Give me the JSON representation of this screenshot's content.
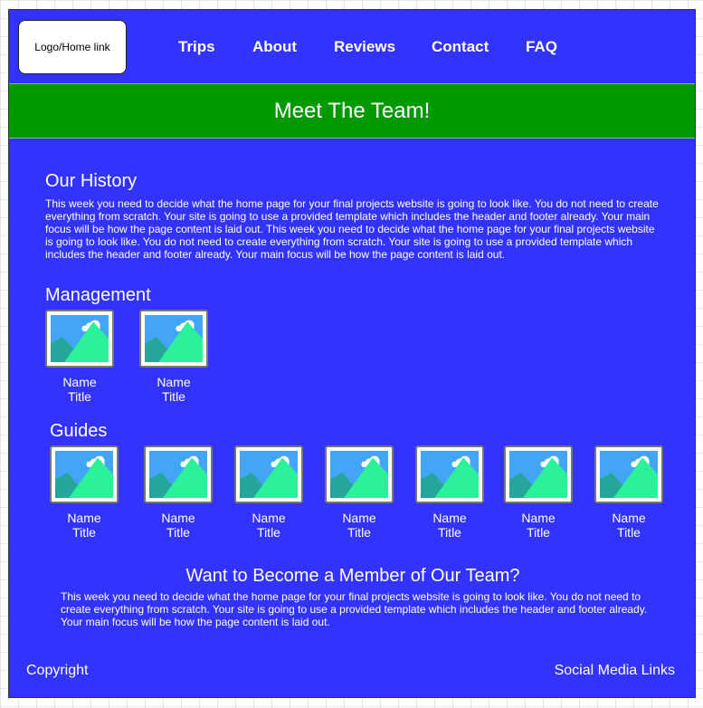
{
  "header": {
    "logo": "Logo/Home link",
    "nav": [
      "Trips",
      "About",
      "Reviews",
      "Contact",
      "FAQ"
    ]
  },
  "banner": {
    "title": "Meet The Team!"
  },
  "history": {
    "heading": "Our History",
    "text": "This week you need to decide what the home page for your final projects website is going to look like. You do not need to create everything from scratch. Your site is going to use a provided template which includes the header and footer already. Your main focus will be how the page content is laid out. This week you need to decide what the home page for your final projects website is going to look like. You do not need to create everything from scratch. Your site is going to use a provided template which includes the header and footer already. Your main focus will be how the page content is laid out."
  },
  "management": {
    "heading": "Management",
    "members": [
      {
        "name": "Name",
        "title": "Title"
      },
      {
        "name": "Name",
        "title": "Title"
      }
    ]
  },
  "guides": {
    "heading": "Guides",
    "members": [
      {
        "name": "Name",
        "title": "Title"
      },
      {
        "name": "Name",
        "title": "Title"
      },
      {
        "name": "Name",
        "title": "Title"
      },
      {
        "name": "Name",
        "title": "Title"
      },
      {
        "name": "Name",
        "title": "Title"
      },
      {
        "name": "Name",
        "title": "Title"
      },
      {
        "name": "Name",
        "title": "Title"
      }
    ]
  },
  "join": {
    "heading": "Want to Become a Member of Our Team?",
    "text": "This week you need to decide what the home page for your final projects website is going to look like. You do not need to create everything from scratch. Your site is going to use a provided template which includes the header and footer already. Your main focus will be how the page content is laid out."
  },
  "footer": {
    "left": "Copyright",
    "right": "Social Media Links"
  },
  "colors": {
    "page_bg": "#3333ff",
    "banner_bg": "#009900",
    "text": "#ffffff"
  },
  "icons": {
    "placeholder": "image-placeholder-icon"
  }
}
